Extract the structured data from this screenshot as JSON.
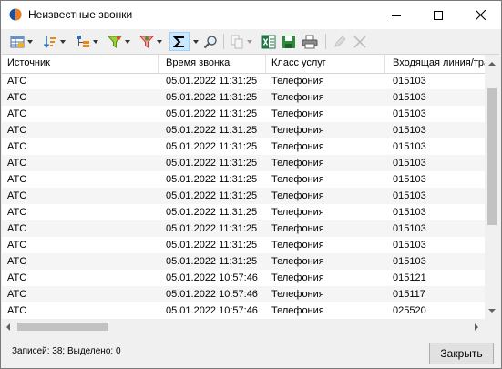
{
  "window": {
    "title": "Неизвестные звонки",
    "buttons": {
      "minimize": "minimize",
      "maximize": "maximize",
      "close": "close"
    }
  },
  "toolbar": {
    "items": [
      {
        "icon": "table-view-icon",
        "dropdown": true
      },
      {
        "icon": "sort-icon",
        "dropdown": true
      },
      {
        "icon": "group-tree-icon",
        "dropdown": true
      },
      {
        "icon": "filter-icon",
        "dropdown": true
      },
      {
        "icon": "filter-clear-icon",
        "dropdown": true
      },
      {
        "icon": "sum-icon",
        "dropdown": true,
        "active": true
      },
      {
        "icon": "search-icon",
        "dropdown": false
      },
      {
        "icon": "copy-icon",
        "dropdown": true,
        "disabled": true
      },
      {
        "icon": "export-excel-icon",
        "dropdown": false
      },
      {
        "icon": "save-icon",
        "dropdown": false
      },
      {
        "icon": "print-icon",
        "dropdown": false
      },
      {
        "icon": "edit-icon",
        "dropdown": false,
        "disabled": true
      },
      {
        "icon": "delete-icon",
        "dropdown": false,
        "disabled": true
      }
    ]
  },
  "grid": {
    "columns": [
      "Источник",
      "Время звонка",
      "Класс услуг",
      "Входящая линия/транк"
    ],
    "rows": [
      [
        "АТС",
        "05.01.2022 11:31:25",
        "Телефония",
        "015103"
      ],
      [
        "АТС",
        "05.01.2022 11:31:25",
        "Телефония",
        "015103"
      ],
      [
        "АТС",
        "05.01.2022 11:31:25",
        "Телефония",
        "015103"
      ],
      [
        "АТС",
        "05.01.2022 11:31:25",
        "Телефония",
        "015103"
      ],
      [
        "АТС",
        "05.01.2022 11:31:25",
        "Телефония",
        "015103"
      ],
      [
        "АТС",
        "05.01.2022 11:31:25",
        "Телефония",
        "015103"
      ],
      [
        "АТС",
        "05.01.2022 11:31:25",
        "Телефония",
        "015103"
      ],
      [
        "АТС",
        "05.01.2022 11:31:25",
        "Телефония",
        "015103"
      ],
      [
        "АТС",
        "05.01.2022 11:31:25",
        "Телефония",
        "015103"
      ],
      [
        "АТС",
        "05.01.2022 11:31:25",
        "Телефония",
        "015103"
      ],
      [
        "АТС",
        "05.01.2022 11:31:25",
        "Телефония",
        "015103"
      ],
      [
        "АТС",
        "05.01.2022 11:31:25",
        "Телефония",
        "015103"
      ],
      [
        "АТС",
        "05.01.2022 10:57:46",
        "Телефония",
        "015121"
      ],
      [
        "АТС",
        "05.01.2022 10:57:46",
        "Телефония",
        "015117"
      ],
      [
        "АТС",
        "05.01.2022 10:57:46",
        "Телефония",
        "025520"
      ]
    ]
  },
  "status": {
    "text": "Записей: 38; Выделено: 0"
  },
  "footer": {
    "close_label": "Закрыть"
  },
  "colors": {
    "accent_active": "#cce8ff",
    "row_alt": "#f5f5f5",
    "excel_green": "#217346"
  }
}
